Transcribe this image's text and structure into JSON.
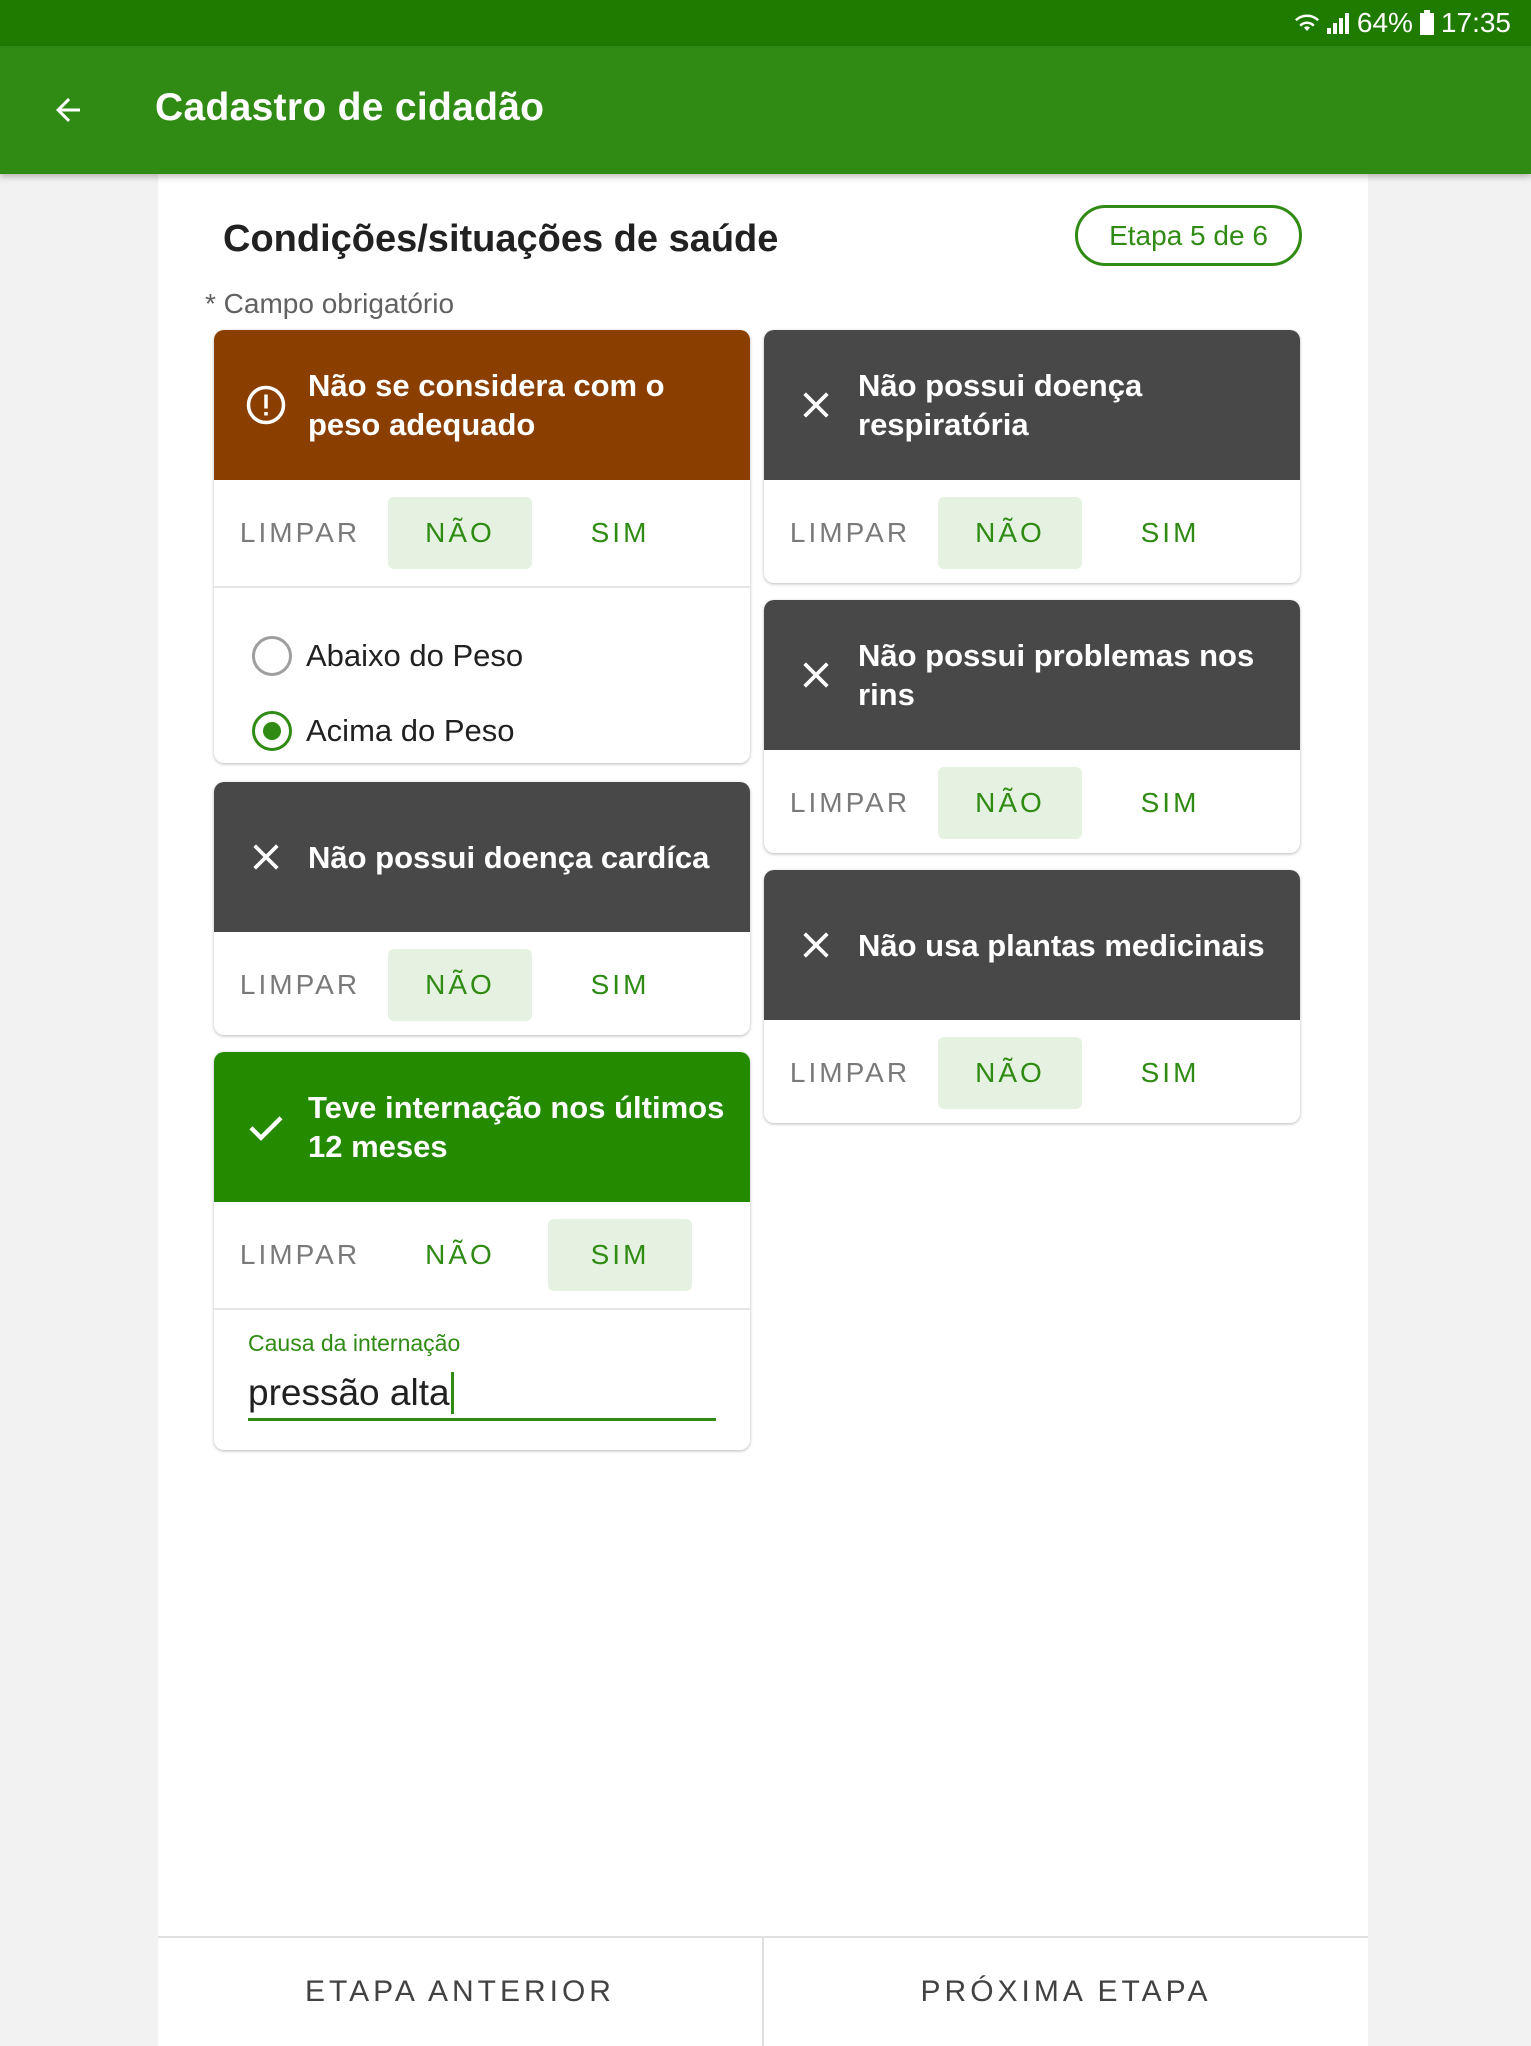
{
  "status_bar": {
    "battery": "64%",
    "time": "17:35"
  },
  "app_bar": {
    "title": "Cadastro de cidadão"
  },
  "page": {
    "title": "Condições/situações de saúde",
    "step": "Etapa 5 de 6",
    "required_note": "* Campo obrigatório"
  },
  "conditions": [
    {
      "label": "Não se considera com o peso adequado",
      "status": "warning",
      "buttons": {
        "clear": "LIMPAR",
        "no": "NÃO",
        "yes": "SIM"
      },
      "selected": "NÃO",
      "options": [
        {
          "label": "Abaixo do Peso",
          "checked": false
        },
        {
          "label": "Acima do Peso",
          "checked": true
        }
      ]
    },
    {
      "label": "Não possui doença cardíca",
      "status": "no",
      "buttons": {
        "clear": "LIMPAR",
        "no": "NÃO",
        "yes": "SIM"
      },
      "selected": "NÃO"
    },
    {
      "label": "Teve internação nos últimos 12 meses",
      "status": "yes",
      "buttons": {
        "clear": "LIMPAR",
        "no": "NÃO",
        "yes": "SIM"
      },
      "selected": "SIM",
      "field": {
        "label": "Causa da internação",
        "value": "pressão alta"
      }
    },
    {
      "label": "Não possui doença respiratória",
      "status": "no",
      "buttons": {
        "clear": "LIMPAR",
        "no": "NÃO",
        "yes": "SIM"
      },
      "selected": "NÃO"
    },
    {
      "label": "Não possui problemas nos rins",
      "status": "no",
      "buttons": {
        "clear": "LIMPAR",
        "no": "NÃO",
        "yes": "SIM"
      },
      "selected": "NÃO"
    },
    {
      "label": "Não usa plantas medicinais",
      "status": "no",
      "buttons": {
        "clear": "LIMPAR",
        "no": "NÃO",
        "yes": "SIM"
      },
      "selected": "NÃO"
    }
  ],
  "footer": {
    "prev": "ETAPA ANTERIOR",
    "next": "PRÓXIMA ETAPA"
  },
  "colors": {
    "primary": "#2f8b13",
    "status_bar": "#1f7a00",
    "warning_header": "#8a3e00",
    "negative_header": "#484848",
    "positive_header": "#248a00",
    "selected_button_bg": "#e6f2e1"
  },
  "icons": {
    "back": "arrow-left-icon",
    "warning": "alert-circle-icon",
    "negative": "close-icon",
    "positive": "check-icon"
  }
}
